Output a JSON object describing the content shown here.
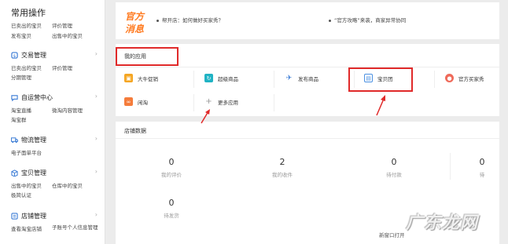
{
  "sidebar": {
    "title": "常用操作",
    "quick_links": [
      "已卖出的宝贝",
      "评价管理",
      "发布宝贝",
      "出售中的宝贝"
    ],
    "sections": [
      {
        "label": "交易管理",
        "icon": "trade-icon",
        "links": [
          "已卖出的宝贝",
          "评价管理",
          "分期管理"
        ]
      },
      {
        "label": "自运营中心",
        "icon": "chat-icon",
        "links": [
          "淘宝直播",
          "微淘内容管理",
          "淘宝群"
        ]
      },
      {
        "label": "物流管理",
        "icon": "truck-icon",
        "links": [
          "电子面单平台"
        ]
      },
      {
        "label": "宝贝管理",
        "icon": "box-icon",
        "links": [
          "出售中的宝贝",
          "仓库中的宝贝",
          "极简认证"
        ]
      },
      {
        "label": "店铺管理",
        "icon": "shop-icon",
        "links": [
          "查看淘宝店铺",
          "子账号个人信息管理"
        ]
      }
    ]
  },
  "notice": {
    "logo_line1": "官方",
    "logo_line2": "消息",
    "item1": "帮开店：如何做好买家秀？",
    "item2": "“官方攻略”来袭，商家异常协同"
  },
  "apps": {
    "title": "我的应用",
    "items": [
      {
        "label": "大牛促销",
        "icon": "promo-icon",
        "color": "#f5a623"
      },
      {
        "label": "超级商品",
        "icon": "sync-icon",
        "color": "#20b3c4"
      },
      {
        "label": "发布商品",
        "icon": "send-icon",
        "color": "#3a7bd5"
      },
      {
        "label": "宝贝团",
        "icon": "group-icon",
        "color": "#4a90e2"
      },
      {
        "label": "官方买家秀",
        "icon": "show-icon",
        "color": "#ef6a5a"
      },
      {
        "label": "闲淘",
        "icon": "idle-icon",
        "color": "#f57c3b"
      },
      {
        "label": "更多应用",
        "icon": "plus-icon",
        "color": "#999999"
      }
    ]
  },
  "shop": {
    "title": "店铺数据",
    "stats": [
      {
        "value": "0",
        "label": "我的评价"
      },
      {
        "value": "2",
        "label": "我的收件"
      },
      {
        "value": "0",
        "label": "待付款"
      },
      {
        "value": "0",
        "label": "待"
      },
      {
        "value": "0",
        "label": "待发货"
      }
    ],
    "new_window": "新窗口打开"
  },
  "watermark": "广东龙网",
  "colors": {
    "highlight": "#e02a2a",
    "brand": "#ff7a1f"
  }
}
